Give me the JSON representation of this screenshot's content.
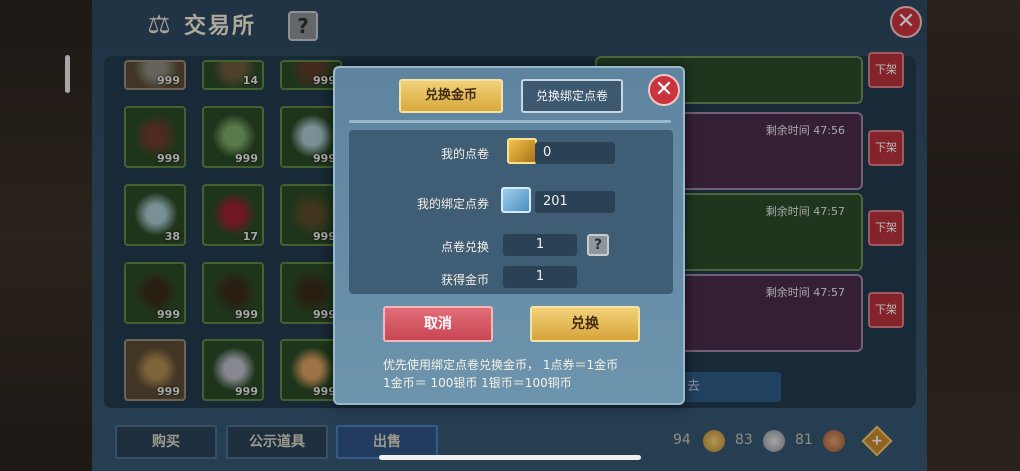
{
  "exchange": {
    "title": "交易所",
    "help_label": "?",
    "close_label": "✕",
    "items": [
      {
        "qty": "999",
        "color": "#8a8a80"
      },
      {
        "qty": "14",
        "color": "#6c5b3d"
      },
      {
        "qty": "999",
        "color": "#5c3b2a"
      },
      {
        "qty": "999",
        "color": "#6b3a2a"
      },
      {
        "qty": "999",
        "color": "#7cab6a"
      },
      {
        "qty": "999",
        "color": "#a8c8d0"
      },
      {
        "qty": "38",
        "color": "#a8c8d0"
      },
      {
        "qty": "17",
        "color": "#9a2030"
      },
      {
        "qty": "999",
        "color": "#5a4a2a"
      },
      {
        "qty": "999",
        "color": "#3a2a1a"
      },
      {
        "qty": "999",
        "color": "#3a2a1a"
      },
      {
        "qty": "999",
        "color": "#3a2a1a"
      },
      {
        "qty": "999",
        "color": "#b08a50"
      },
      {
        "qty": "999",
        "color": "#bcbcc8"
      },
      {
        "qty": "999",
        "color": "#d8a060"
      }
    ],
    "listings": [
      {
        "time": "",
        "off_label": "下架"
      },
      {
        "time": "剩余时间  47:56",
        "off_label": "下架"
      },
      {
        "time": "剩余时间  47:57",
        "off_label": "下架"
      },
      {
        "time": "剩余时间  47:57",
        "off_label": "下架"
      }
    ],
    "behind_button_label": "去",
    "tabs": {
      "buy": "购买",
      "public": "公示道具",
      "sell": "出售"
    },
    "currency": {
      "gold": "94",
      "silver": "83",
      "copper": "81"
    }
  },
  "modal": {
    "tab_coin": "兑换金币",
    "tab_bound": "兑换绑定点卷",
    "close_label": "✕",
    "my_points_label": "我的点卷",
    "my_points_value": "0",
    "my_bound_label": "我的绑定点券",
    "my_bound_value": "201",
    "exchange_label": "点卷兑换",
    "exchange_value": "1",
    "obtain_label": "获得金币",
    "obtain_value": "1",
    "help_label": "?",
    "cancel_label": "取消",
    "ok_label": "兑换",
    "note_line1": "优先使用绑定点卷兑换金币，  1点券＝1金币",
    "note_line2": "1金币＝ 100银币   1银币＝100铜币"
  },
  "colors": {
    "gold_button": "#e0b24c",
    "cancel_button": "#d2545f",
    "close_red": "#c9343f"
  }
}
